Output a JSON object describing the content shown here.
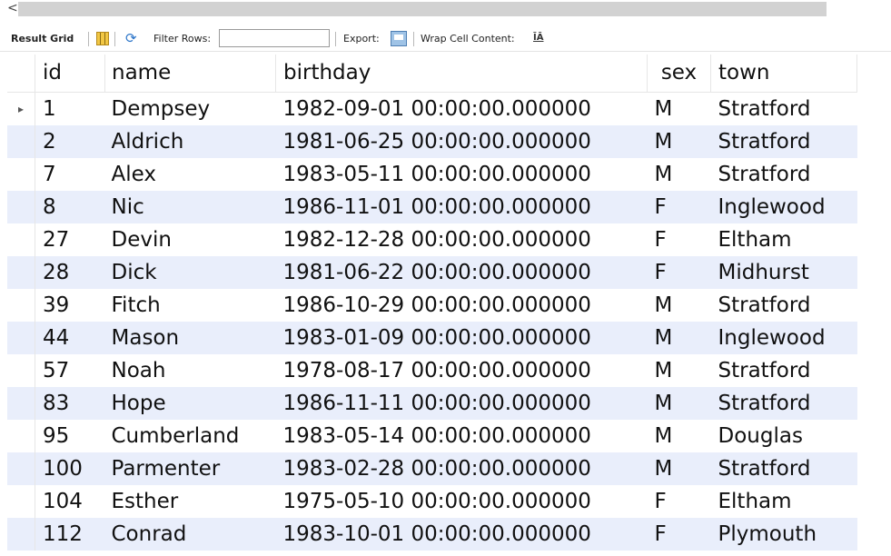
{
  "scrollbar": {
    "left_arrow": "<"
  },
  "toolbar": {
    "result_grid_label": "Result Grid",
    "filter_rows_label": "Filter Rows:",
    "filter_rows_value": "",
    "export_label": "Export:",
    "wrap_label": "Wrap Cell Content:",
    "wrap_icon": "ĪĀ"
  },
  "grid": {
    "columns": [
      "id",
      "name",
      "birthday",
      "sex",
      "town"
    ],
    "selected_row_marker": "▸",
    "rows": [
      [
        "1",
        "Dempsey",
        "1982-09-01 00:00:00.000000",
        "M",
        "Stratford"
      ],
      [
        "2",
        "Aldrich",
        "1981-06-25 00:00:00.000000",
        "M",
        "Stratford"
      ],
      [
        "7",
        "Alex",
        "1983-05-11 00:00:00.000000",
        "M",
        "Stratford"
      ],
      [
        "8",
        "Nic",
        "1986-11-01 00:00:00.000000",
        "F",
        "Inglewood"
      ],
      [
        "27",
        "Devin",
        "1982-12-28 00:00:00.000000",
        "F",
        "Eltham"
      ],
      [
        "28",
        "Dick",
        "1981-06-22 00:00:00.000000",
        "F",
        "Midhurst"
      ],
      [
        "39",
        "Fitch",
        "1986-10-29 00:00:00.000000",
        "M",
        "Stratford"
      ],
      [
        "44",
        "Mason",
        "1983-01-09 00:00:00.000000",
        "M",
        "Inglewood"
      ],
      [
        "57",
        "Noah",
        "1978-08-17 00:00:00.000000",
        "M",
        "Stratford"
      ],
      [
        "83",
        "Hope",
        "1986-11-11 00:00:00.000000",
        "M",
        "Stratford"
      ],
      [
        "95",
        "Cumberland",
        "1983-05-14 00:00:00.000000",
        "M",
        "Douglas"
      ],
      [
        "100",
        "Parmenter",
        "1983-02-28 00:00:00.000000",
        "M",
        "Stratford"
      ],
      [
        "104",
        "Esther",
        "1975-05-10 00:00:00.000000",
        "F",
        "Eltham"
      ],
      [
        "112",
        "Conrad",
        "1983-10-01 00:00:00.000000",
        "F",
        "Plymouth"
      ]
    ]
  },
  "colors": {
    "row_alt": "#e9eefb",
    "scrollbar_thumb": "#d2d2d2"
  }
}
